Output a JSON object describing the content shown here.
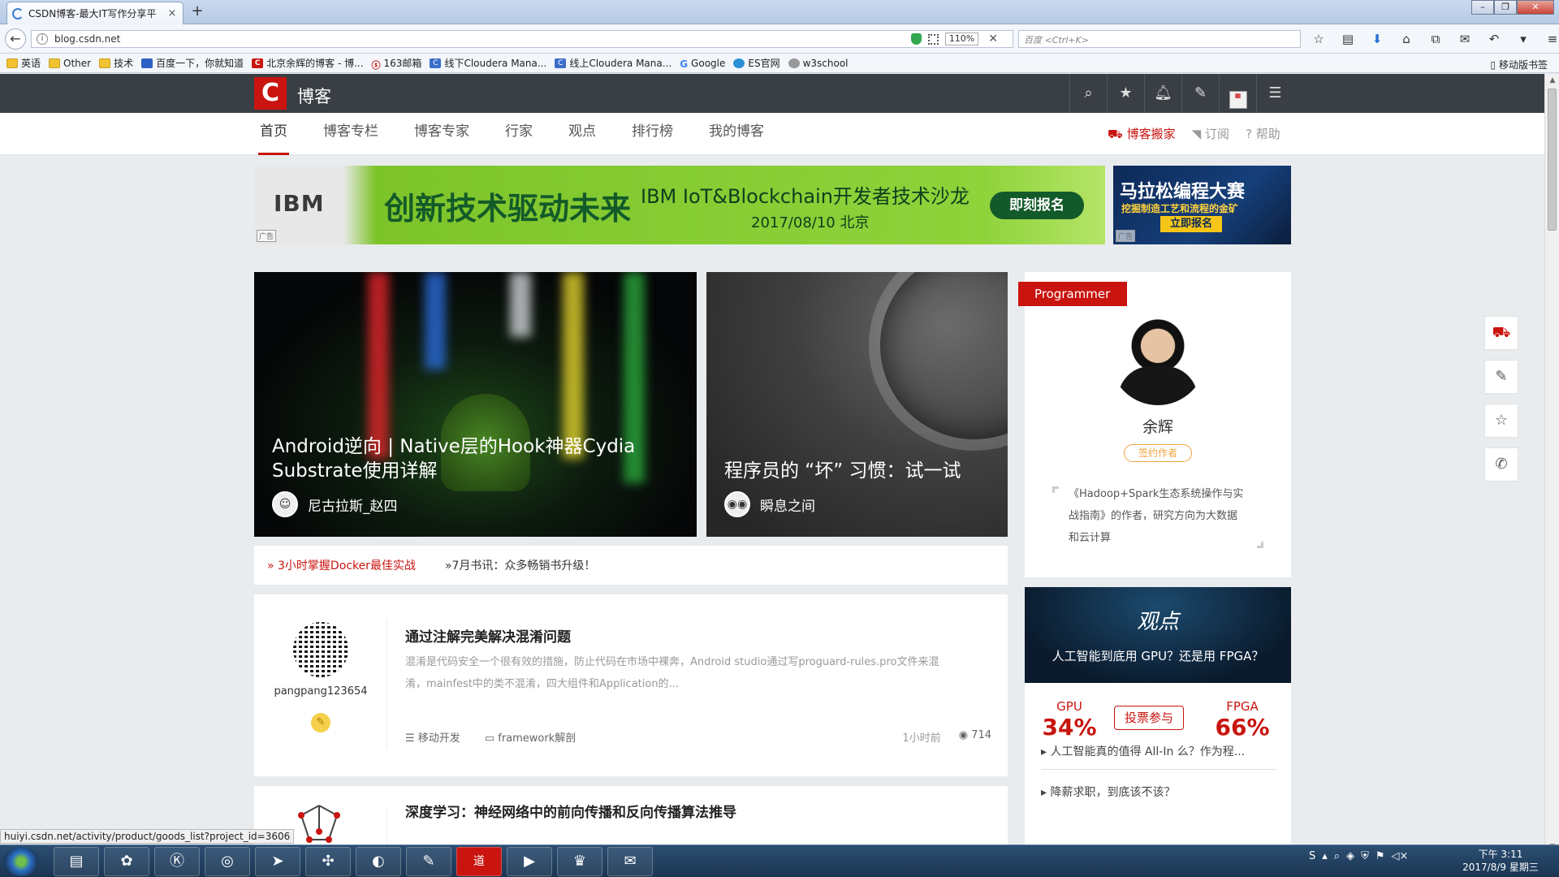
{
  "browser": {
    "tab_title": "CSDN博客-最大IT写作分享平",
    "url": "blog.csdn.net",
    "zoom": "110%",
    "search_placeholder": "百度 <Ctrl+K>",
    "bookmarks": [
      {
        "label": "英语",
        "icon": "folder-icon"
      },
      {
        "label": "Other",
        "icon": "folder-icon"
      },
      {
        "label": "技术",
        "icon": "folder-icon"
      },
      {
        "label": "百度一下，你就知道",
        "icon": "baidu-icon"
      },
      {
        "label": "北京余辉的博客 - 博...",
        "icon": "csdn-icon"
      },
      {
        "label": "163邮箱",
        "icon": "mail-icon"
      },
      {
        "label": "线下Cloudera Mana...",
        "icon": "cloudera-icon"
      },
      {
        "label": "线上Cloudera Mana...",
        "icon": "cloudera-icon"
      },
      {
        "label": "Google",
        "icon": "google-icon"
      },
      {
        "label": "ES官网",
        "icon": "es-icon"
      },
      {
        "label": "w3school",
        "icon": "w3school-icon"
      }
    ],
    "mobile_bookmarks": "移动版书签"
  },
  "site": {
    "logo_letter": "C",
    "title": "博客",
    "nav": [
      "首页",
      "博客专栏",
      "博客专家",
      "行家",
      "观点",
      "排行榜",
      "我的博客"
    ],
    "nav_active": "首页",
    "right_links": [
      "博客搬家",
      "订阅",
      "帮助"
    ]
  },
  "ads": {
    "ibm": {
      "brand": "IBM",
      "slogan": "创新技术驱动未来",
      "subtitle": "IBM IoT&Blockchain开发者技术沙龙",
      "date": "2017/08/10 北京",
      "button": "即刻报名",
      "tag": "广告"
    },
    "marathon": {
      "title": "马拉松编程大赛",
      "subtitle": "挖掘制造工艺和流程的金矿",
      "button": "立即报名",
      "tag": "广告"
    }
  },
  "hero": [
    {
      "title": "Android逆向 | Native层的Hook神器Cydia Substrate使用详解",
      "author": "尼古拉斯_赵四"
    },
    {
      "title": "程序员的 “坏” 习惯：试一试",
      "author": "瞬息之间"
    }
  ],
  "ticker": [
    "» 3小时掌握Docker最佳实战",
    "»7月书讯：众多畅销书升级！"
  ],
  "articles": [
    {
      "author": "pangpang123654",
      "title": "通过注解完美解决混淆问题",
      "desc": "混淆是代码安全一个很有效的措施，防止代码在市场中裸奔，Android studio通过写proguard-rules.pro文件来混淆，mainfest中的类不混淆，四大组件和Application的...",
      "category": "移动开发",
      "tag": "framework解剖",
      "time": "1小时前",
      "views": "714"
    },
    {
      "author": "",
      "title": "深度学习：神经网络中的前向传播和反向传播算法推导",
      "desc": "",
      "category": "",
      "tag": "",
      "time": "",
      "views": ""
    }
  ],
  "sidebar": {
    "ribbon": "Programmer",
    "name": "余辉",
    "tag": "签约作者",
    "bio": "《Hadoop+Spark生态系统操作与实战指南》的作者，研究方向为大数据和云计算",
    "opinion": {
      "logo": "观点",
      "question": "人工智能到底用 GPU？还是用 FPGA？",
      "left_label": "GPU",
      "left_pct": "34%",
      "right_label": "FPGA",
      "right_pct": "66%",
      "vote_button": "投票参与",
      "links": [
        "人工智能真的值得 All-In 么？作为程...",
        "降薪求职，到底该不该？"
      ]
    }
  },
  "status_url": "huiyi.csdn.net/activity/product/goods_list?project_id=3606",
  "taskbar": {
    "time": "下午 3:11",
    "date": "2017/8/9 星期三"
  }
}
